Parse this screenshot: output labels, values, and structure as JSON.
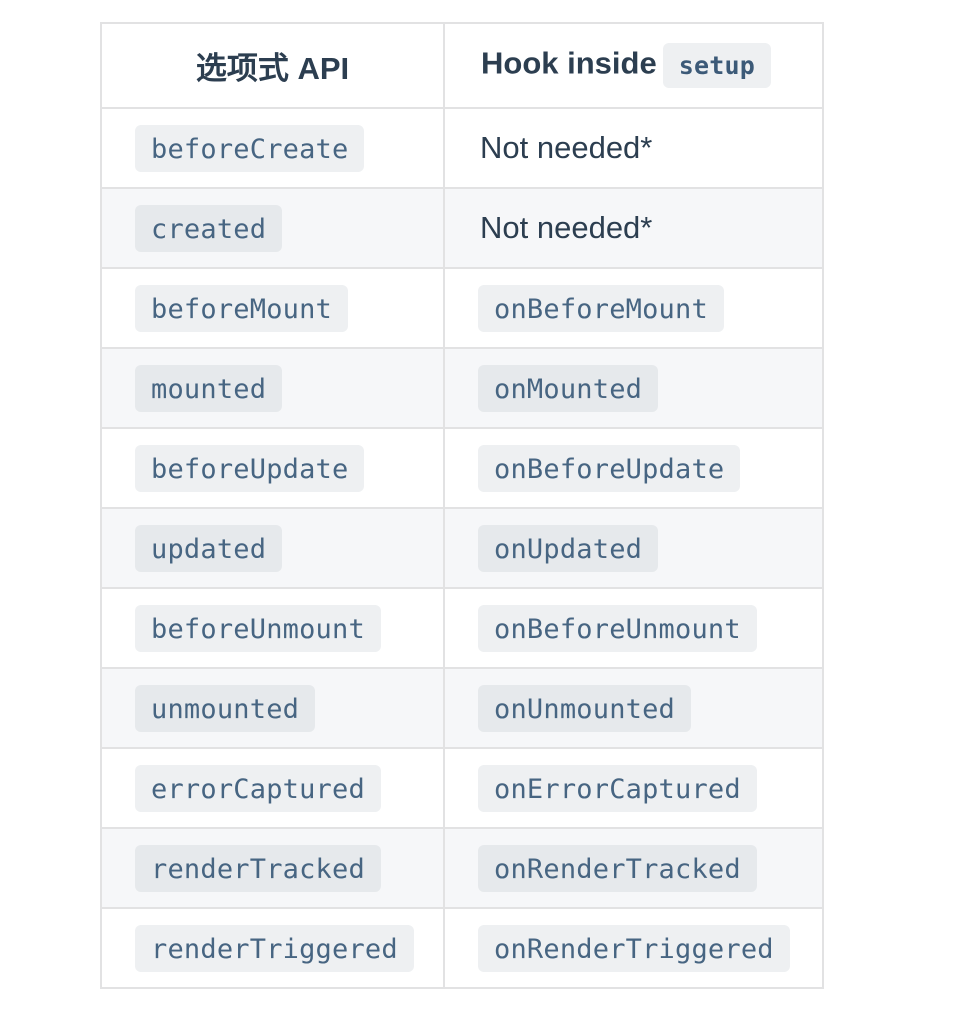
{
  "header": {
    "col1": "选项式 API",
    "col2_text": "Hook inside",
    "col2_code": "setup"
  },
  "rows": [
    {
      "options": "beforeCreate",
      "hook": "Not needed*",
      "hook_is_code": false
    },
    {
      "options": "created",
      "hook": "Not needed*",
      "hook_is_code": false
    },
    {
      "options": "beforeMount",
      "hook": "onBeforeMount",
      "hook_is_code": true
    },
    {
      "options": "mounted",
      "hook": "onMounted",
      "hook_is_code": true
    },
    {
      "options": "beforeUpdate",
      "hook": "onBeforeUpdate",
      "hook_is_code": true
    },
    {
      "options": "updated",
      "hook": "onUpdated",
      "hook_is_code": true
    },
    {
      "options": "beforeUnmount",
      "hook": "onBeforeUnmount",
      "hook_is_code": true
    },
    {
      "options": "unmounted",
      "hook": "onUnmounted",
      "hook_is_code": true
    },
    {
      "options": "errorCaptured",
      "hook": "onErrorCaptured",
      "hook_is_code": true
    },
    {
      "options": "renderTracked",
      "hook": "onRenderTracked",
      "hook_is_code": true
    },
    {
      "options": "renderTriggered",
      "hook": "onRenderTriggered",
      "hook_is_code": true
    }
  ]
}
